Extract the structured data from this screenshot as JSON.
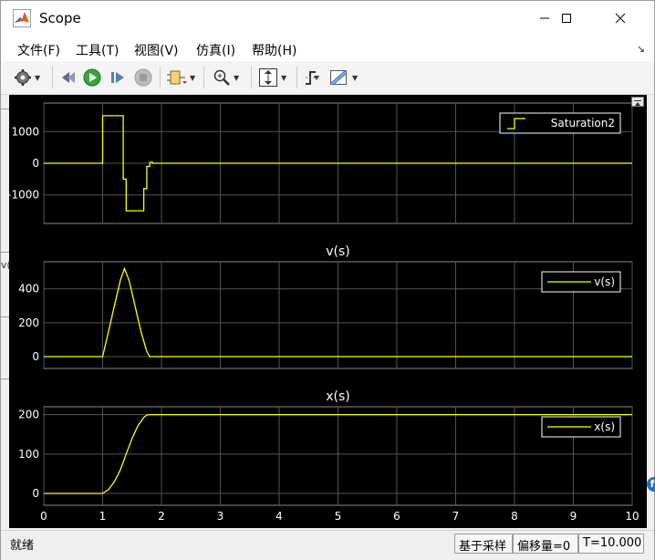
{
  "window": {
    "title": "Scope"
  },
  "menu": {
    "items": [
      "文件(F)",
      "工具(T)",
      "视图(V)",
      "仿真(I)",
      "帮助(H)"
    ]
  },
  "toolbar": {
    "icons": [
      "gear-icon",
      "run-backward-icon",
      "run-icon",
      "step-forward-icon",
      "stop-icon",
      "signal-select-icon",
      "zoom-icon",
      "scale-axes-icon",
      "trigger-icon",
      "measure-icon"
    ]
  },
  "status": {
    "left": "就绪",
    "sample_mode": "基于采样",
    "offset": "偏移量=0",
    "time": "T=10.000"
  },
  "side_fragment": "v(",
  "colors": {
    "background": "#000000",
    "axes": "#000000",
    "grid": "#545454",
    "signal": "#ffff00",
    "text": "#ffffff"
  },
  "chart_data": [
    {
      "type": "line",
      "title": "",
      "ylim": [
        -1900,
        1900
      ],
      "yticks": [
        -1000,
        0,
        1000
      ],
      "xlim": [
        0,
        10
      ],
      "legend": "Saturation2",
      "legend_placement": "top-right",
      "grid": true,
      "series": [
        {
          "name": "Saturation2",
          "x": [
            0,
            1.0,
            1.0,
            1.35,
            1.35,
            1.4,
            1.4,
            1.7,
            1.7,
            1.75,
            1.75,
            1.8,
            1.8,
            1.85,
            1.85,
            10
          ],
          "y": [
            0,
            0,
            1500,
            1500,
            -500,
            -500,
            -1500,
            -1500,
            -800,
            -800,
            -100,
            -100,
            30,
            30,
            0,
            0
          ]
        }
      ]
    },
    {
      "type": "line",
      "title": "v(s)",
      "ylim": [
        -70,
        560
      ],
      "yticks": [
        0,
        200,
        400
      ],
      "xlim": [
        0,
        10
      ],
      "legend": "v(s)",
      "legend_placement": "top-right",
      "grid": true,
      "series": [
        {
          "name": "v(s)",
          "x": [
            0,
            1.0,
            1.1,
            1.2,
            1.3,
            1.37,
            1.45,
            1.55,
            1.65,
            1.75,
            1.8,
            1.85,
            10
          ],
          "y": [
            0,
            0,
            150,
            300,
            450,
            520,
            450,
            300,
            150,
            30,
            0,
            0,
            0
          ]
        }
      ]
    },
    {
      "type": "line",
      "title": "x(s)",
      "ylim": [
        -30,
        220
      ],
      "yticks": [
        0,
        100,
        200
      ],
      "xlim": [
        0,
        10
      ],
      "xticks": [
        0,
        1,
        2,
        3,
        4,
        5,
        6,
        7,
        8,
        9,
        10
      ],
      "legend": "x(s)",
      "legend_placement": "top-right",
      "grid": true,
      "series": [
        {
          "name": "x(s)",
          "x": [
            0,
            1.0,
            1.1,
            1.2,
            1.3,
            1.4,
            1.5,
            1.6,
            1.7,
            1.75,
            1.8,
            10
          ],
          "y": [
            0,
            0,
            10,
            30,
            60,
            100,
            140,
            172,
            193,
            199,
            200,
            200
          ]
        }
      ]
    }
  ]
}
